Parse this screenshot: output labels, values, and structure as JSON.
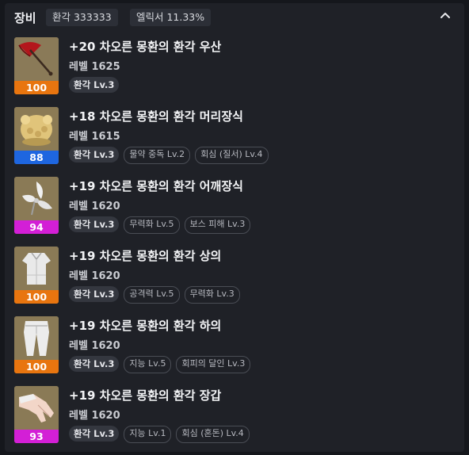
{
  "header": {
    "title": "장비",
    "badge1": "환각 333333",
    "badge2": "엘릭서 11.33%"
  },
  "colors": {
    "orange": "#e8750f",
    "blue": "#1e66e0",
    "magenta": "#d31fd6"
  },
  "items": [
    {
      "name": "+20 차오른 몽환의 환각 우산",
      "level": "레벨 1625",
      "quality": "100",
      "quality_color": "orange",
      "icon": "umbrella-icon",
      "main_tag": "환각 Lv.3",
      "sub_tags": []
    },
    {
      "name": "+18 차오른 몽환의 환각 머리장식",
      "level": "레벨 1615",
      "quality": "88",
      "quality_color": "blue",
      "icon": "headwear-icon",
      "main_tag": "환각 Lv.3",
      "sub_tags": [
        "물약 중독 Lv.2",
        "회심 (질서) Lv.4"
      ]
    },
    {
      "name": "+19 차오른 몽환의 환각 어깨장식",
      "level": "레벨 1620",
      "quality": "94",
      "quality_color": "magenta",
      "icon": "shoulder-icon",
      "main_tag": "환각 Lv.3",
      "sub_tags": [
        "무력화 Lv.5",
        "보스 피해 Lv.3"
      ]
    },
    {
      "name": "+19 차오른 몽환의 환각 상의",
      "level": "레벨 1620",
      "quality": "100",
      "quality_color": "orange",
      "icon": "top-armor-icon",
      "main_tag": "환각 Lv.3",
      "sub_tags": [
        "공격력 Lv.5",
        "무력화 Lv.3"
      ]
    },
    {
      "name": "+19 차오른 몽환의 환각 하의",
      "level": "레벨 1620",
      "quality": "100",
      "quality_color": "orange",
      "icon": "pants-icon",
      "main_tag": "환각 Lv.3",
      "sub_tags": [
        "지능 Lv.5",
        "회피의 달인 Lv.3"
      ]
    },
    {
      "name": "+19 차오른 몽환의 환각 장갑",
      "level": "레벨 1620",
      "quality": "93",
      "quality_color": "magenta",
      "icon": "glove-icon",
      "main_tag": "환각 Lv.3",
      "sub_tags": [
        "지능 Lv.1",
        "회심 (혼돈) Lv.4"
      ]
    }
  ]
}
